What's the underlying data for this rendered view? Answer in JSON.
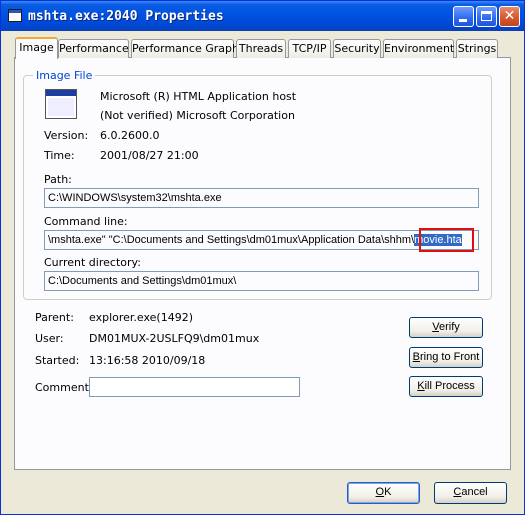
{
  "window": {
    "title": "mshta.exe:2040 Properties",
    "controls": [
      "minimize-icon",
      "maximize-icon",
      "close-icon"
    ]
  },
  "tabs": [
    {
      "label": "Image",
      "active": true
    },
    {
      "label": "Performance",
      "active": false
    },
    {
      "label": "Performance Graph",
      "active": false
    },
    {
      "label": "Threads",
      "active": false
    },
    {
      "label": "TCP/IP",
      "active": false
    },
    {
      "label": "Security",
      "active": false
    },
    {
      "label": "Environment",
      "active": false
    },
    {
      "label": "Strings",
      "active": false
    }
  ],
  "image_file": {
    "group_label": "Image File",
    "description": "Microsoft (R) HTML Application host",
    "company": "(Not verified) Microsoft Corporation",
    "version_label": "Version:",
    "version": "6.0.2600.0",
    "time_label": "Time:",
    "time": "2001/08/27 21:00",
    "path_label": "Path:",
    "path": "C:\\WINDOWS\\system32\\mshta.exe",
    "cmdline_label": "Command line:",
    "cmdline_prefix": "\\mshta.exe\" \"C:\\Documents and Settings\\dm01mux\\Application Data\\shhm\\",
    "cmdline_selected": "movie.hta",
    "curdir_label": "Current directory:",
    "curdir": "C:\\Documents and Settings\\dm01mux\\"
  },
  "process": {
    "parent_label": "Parent:",
    "parent": "explorer.exe(1492)",
    "user_label": "User:",
    "user": "DM01MUX-2USLFQ9\\dm01mux",
    "started_label": "Started:",
    "started": "13:16:58  2010/09/18",
    "comment_label": "Comment:",
    "comment": ""
  },
  "buttons": {
    "verify": {
      "first": "V",
      "rest": "erify"
    },
    "bring_to_front": {
      "first": "B",
      "rest": "ring to Front"
    },
    "kill_process": {
      "first": "K",
      "rest": "ill Process"
    },
    "ok": {
      "first": "O",
      "rest": "K"
    },
    "cancel": {
      "first": "C",
      "rest": "ancel"
    }
  },
  "colors": {
    "title_bar": "#0052e5",
    "group_label": "#0046d5",
    "selection": "#316ac5",
    "annotation": "#e01010"
  }
}
